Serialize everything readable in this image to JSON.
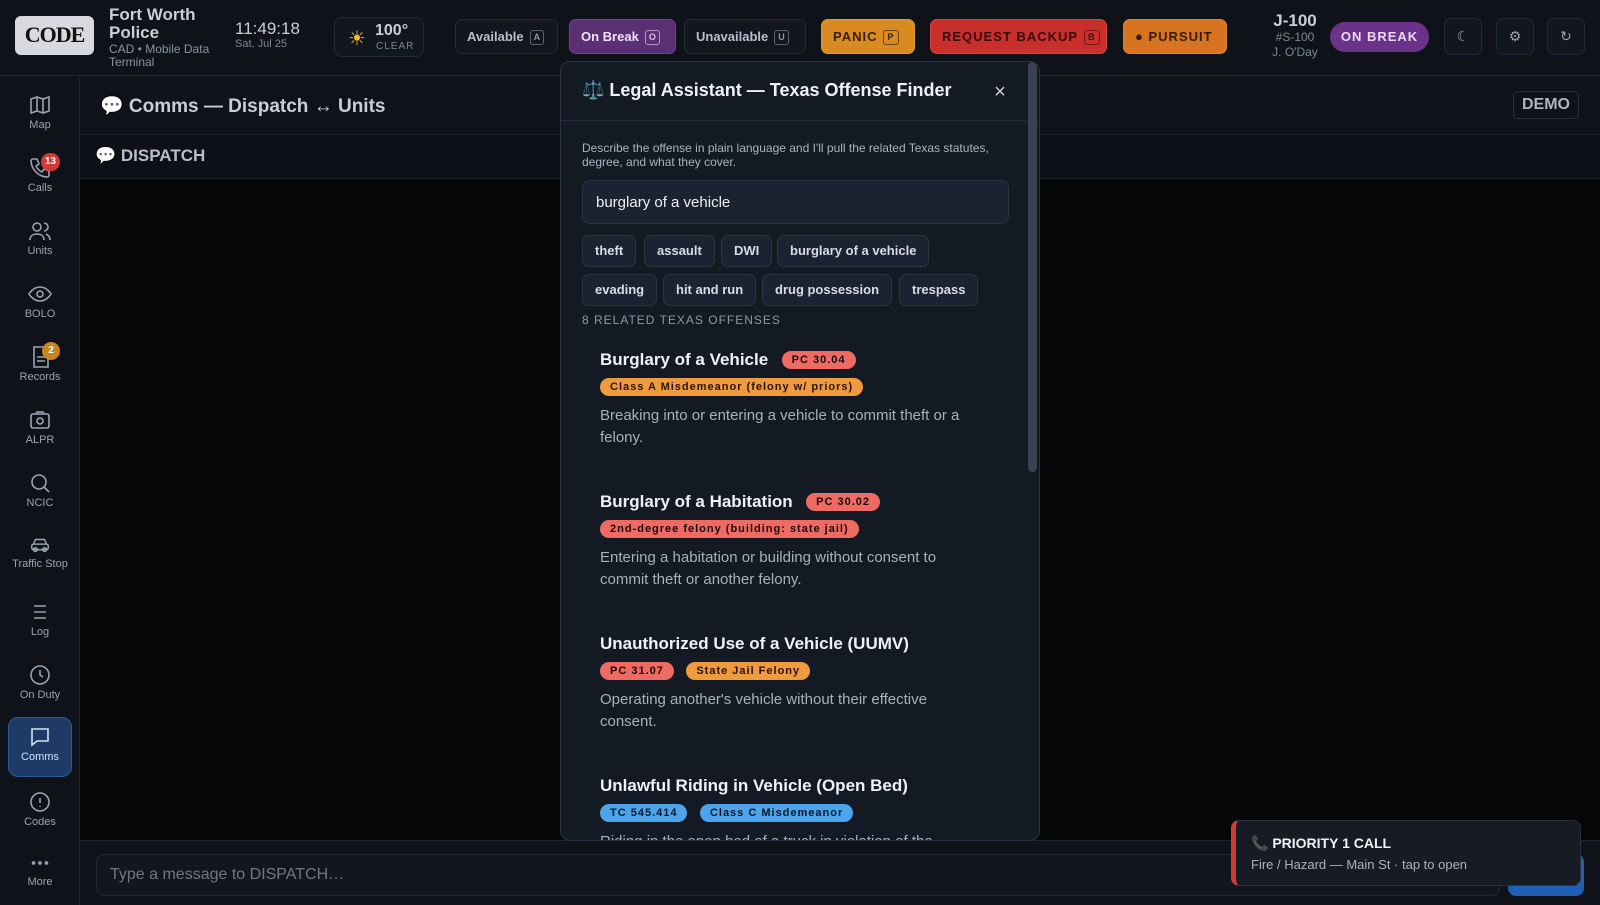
{
  "header": {
    "logo_text": "CODE",
    "agency_name": "Fort Worth Police",
    "agency_sub": "CAD • Mobile Data Terminal",
    "time": "11:49:18",
    "date": "Sat, Jul 25",
    "weather_temp": "100°",
    "weather_cond": "CLEAR",
    "status_buttons": [
      {
        "label": "Available",
        "key": "A"
      },
      {
        "label": "On Break",
        "key": "O"
      },
      {
        "label": "Unavailable",
        "key": "U"
      }
    ],
    "panic": {
      "label": "PANIC",
      "key": "P"
    },
    "backup": {
      "label": "REQUEST BACKUP",
      "key": "B"
    },
    "pursuit": {
      "label": "PURSUIT"
    },
    "unit_id": "J-100",
    "unit_callsign": "#S-100",
    "unit_officer": "J. O'Day",
    "status_pill": "ON BREAK"
  },
  "sidebar": {
    "items": [
      {
        "label": "Map",
        "icon": "map-icon"
      },
      {
        "label": "Calls",
        "icon": "phone-icon",
        "badge": "13"
      },
      {
        "label": "Units",
        "icon": "users-icon"
      },
      {
        "label": "BOLO",
        "icon": "eye-icon"
      },
      {
        "label": "Records",
        "icon": "document-icon",
        "badge": "2"
      },
      {
        "label": "ALPR",
        "icon": "camera-icon"
      },
      {
        "label": "NCIC",
        "icon": "search-icon"
      },
      {
        "label": "Traffic Stop",
        "icon": "car-icon"
      },
      {
        "label": "Log",
        "icon": "list-icon"
      },
      {
        "label": "On Duty",
        "icon": "clock-icon"
      },
      {
        "label": "Comms",
        "icon": "chat-icon",
        "active": true
      },
      {
        "label": "Codes",
        "icon": "info-icon"
      },
      {
        "label": "More",
        "icon": "more-icon"
      }
    ]
  },
  "main": {
    "title": "💬 Comms — Dispatch ↔ Units",
    "demo_badge": "DEMO",
    "channel": "💬 DISPATCH",
    "composer_placeholder": "Type a message to DISPATCH…"
  },
  "modal": {
    "title": "⚖️ Legal Assistant — Texas Offense Finder",
    "close": "×",
    "description": "Describe the offense in plain language and I'll pull the related Texas statutes, degree, and what they cover.",
    "query": "burglary of a vehicle",
    "chips": [
      "theft",
      "assault",
      "DWI",
      "burglary of a vehicle",
      "evading",
      "hit and run",
      "drug possession",
      "trespass"
    ],
    "results_count": "8 RELATED TEXAS OFFENSES",
    "results": [
      {
        "title": "Burglary of a Vehicle",
        "code": "PC 30.04",
        "degree": "Class A Misdemeanor (felony w/ priors)",
        "description": "Breaking into or entering a vehicle to commit theft or a felony."
      },
      {
        "title": "Burglary of a Habitation",
        "code": "PC 30.02",
        "degree": "2nd-degree felony (building: state jail)",
        "description": "Entering a habitation or building without consent to commit theft or another felony."
      },
      {
        "title": "Unauthorized Use of a Vehicle (UUMV)",
        "code": "PC 31.07",
        "degree": "State Jail Felony",
        "description": "Operating another's vehicle without their effective consent."
      },
      {
        "title": "Unlawful Riding in Vehicle (Open Bed)",
        "code": "TC 545.414",
        "degree": "Class C Misdemeanor",
        "description": "Riding in the open bed of a truck in violation of the"
      }
    ]
  },
  "toast": {
    "title": "📞 PRIORITY 1 CALL",
    "subtitle": "Fire / Hazard — Main St · tap to open"
  },
  "colors": {
    "accent": "#1f5fb5",
    "on_break": "#6a3389",
    "panic": "#d98b21",
    "backup": "#c9302c",
    "pursuit": "#d77420",
    "priority": "#d23a35"
  }
}
